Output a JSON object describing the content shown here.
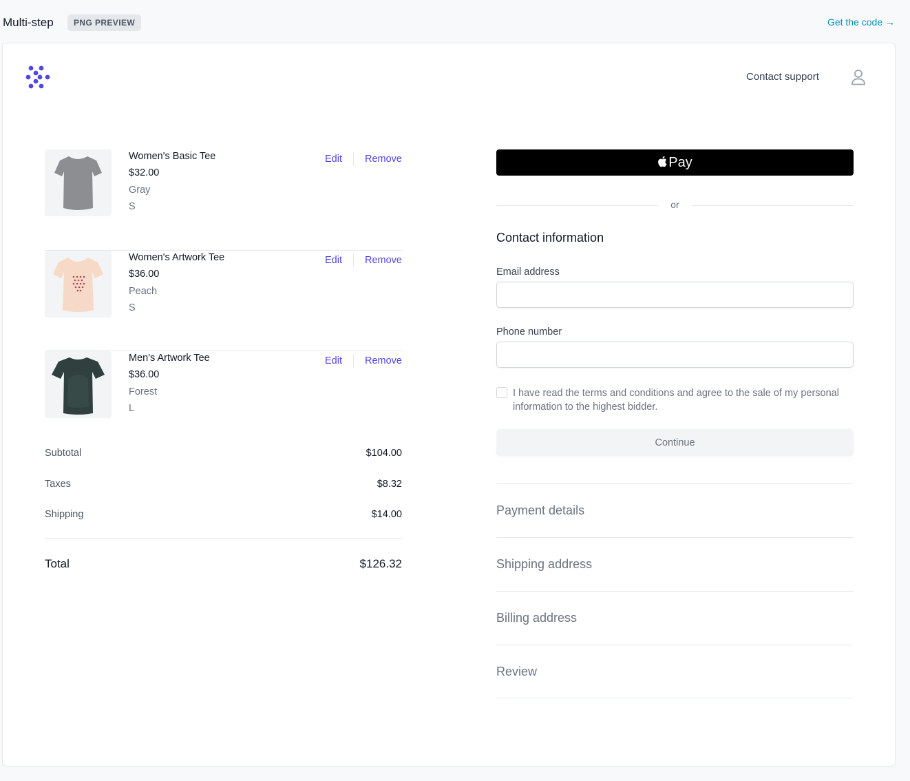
{
  "preview_bar": {
    "title": "Multi-step",
    "badge": "PNG PREVIEW",
    "get_code": "Get the code →"
  },
  "header": {
    "logo_icon": "brand-dots-logo",
    "contact_support": "Contact support",
    "user_icon": "user-icon"
  },
  "cart": {
    "items": [
      {
        "name": "Women's Basic Tee",
        "price": "$32.00",
        "color": "Gray",
        "size": "S",
        "edit": "Edit",
        "remove": "Remove",
        "shirt_color": "#8d8e92"
      },
      {
        "name": "Women's Artwork Tee",
        "price": "$36.00",
        "color": "Peach",
        "size": "S",
        "edit": "Edit",
        "remove": "Remove",
        "shirt_color": "#f6d9c7"
      },
      {
        "name": "Men's Artwork Tee",
        "price": "$36.00",
        "color": "Forest",
        "size": "L",
        "edit": "Edit",
        "remove": "Remove",
        "shirt_color": "#2f403e"
      }
    ]
  },
  "summary": {
    "subtotal_label": "Subtotal",
    "subtotal_value": "$104.00",
    "taxes_label": "Taxes",
    "taxes_value": "$8.32",
    "shipping_label": "Shipping",
    "shipping_value": "$14.00",
    "total_label": "Total",
    "total_value": "$126.32"
  },
  "checkout": {
    "apple_pay_label": "Pay",
    "or": "or",
    "contact_title": "Contact information",
    "email_label": "Email address",
    "email_value": "",
    "phone_label": "Phone number",
    "phone_value": "",
    "terms_text": "I have read the terms and conditions and agree to the sale of my personal information to the highest bidder.",
    "terms_checked": false,
    "continue": "Continue",
    "steps": [
      "Payment details",
      "Shipping address",
      "Billing address",
      "Review"
    ]
  },
  "colors": {
    "accent": "#4f46e5",
    "link_teal": "#0891b2",
    "apple_pay_bg": "#000000"
  }
}
